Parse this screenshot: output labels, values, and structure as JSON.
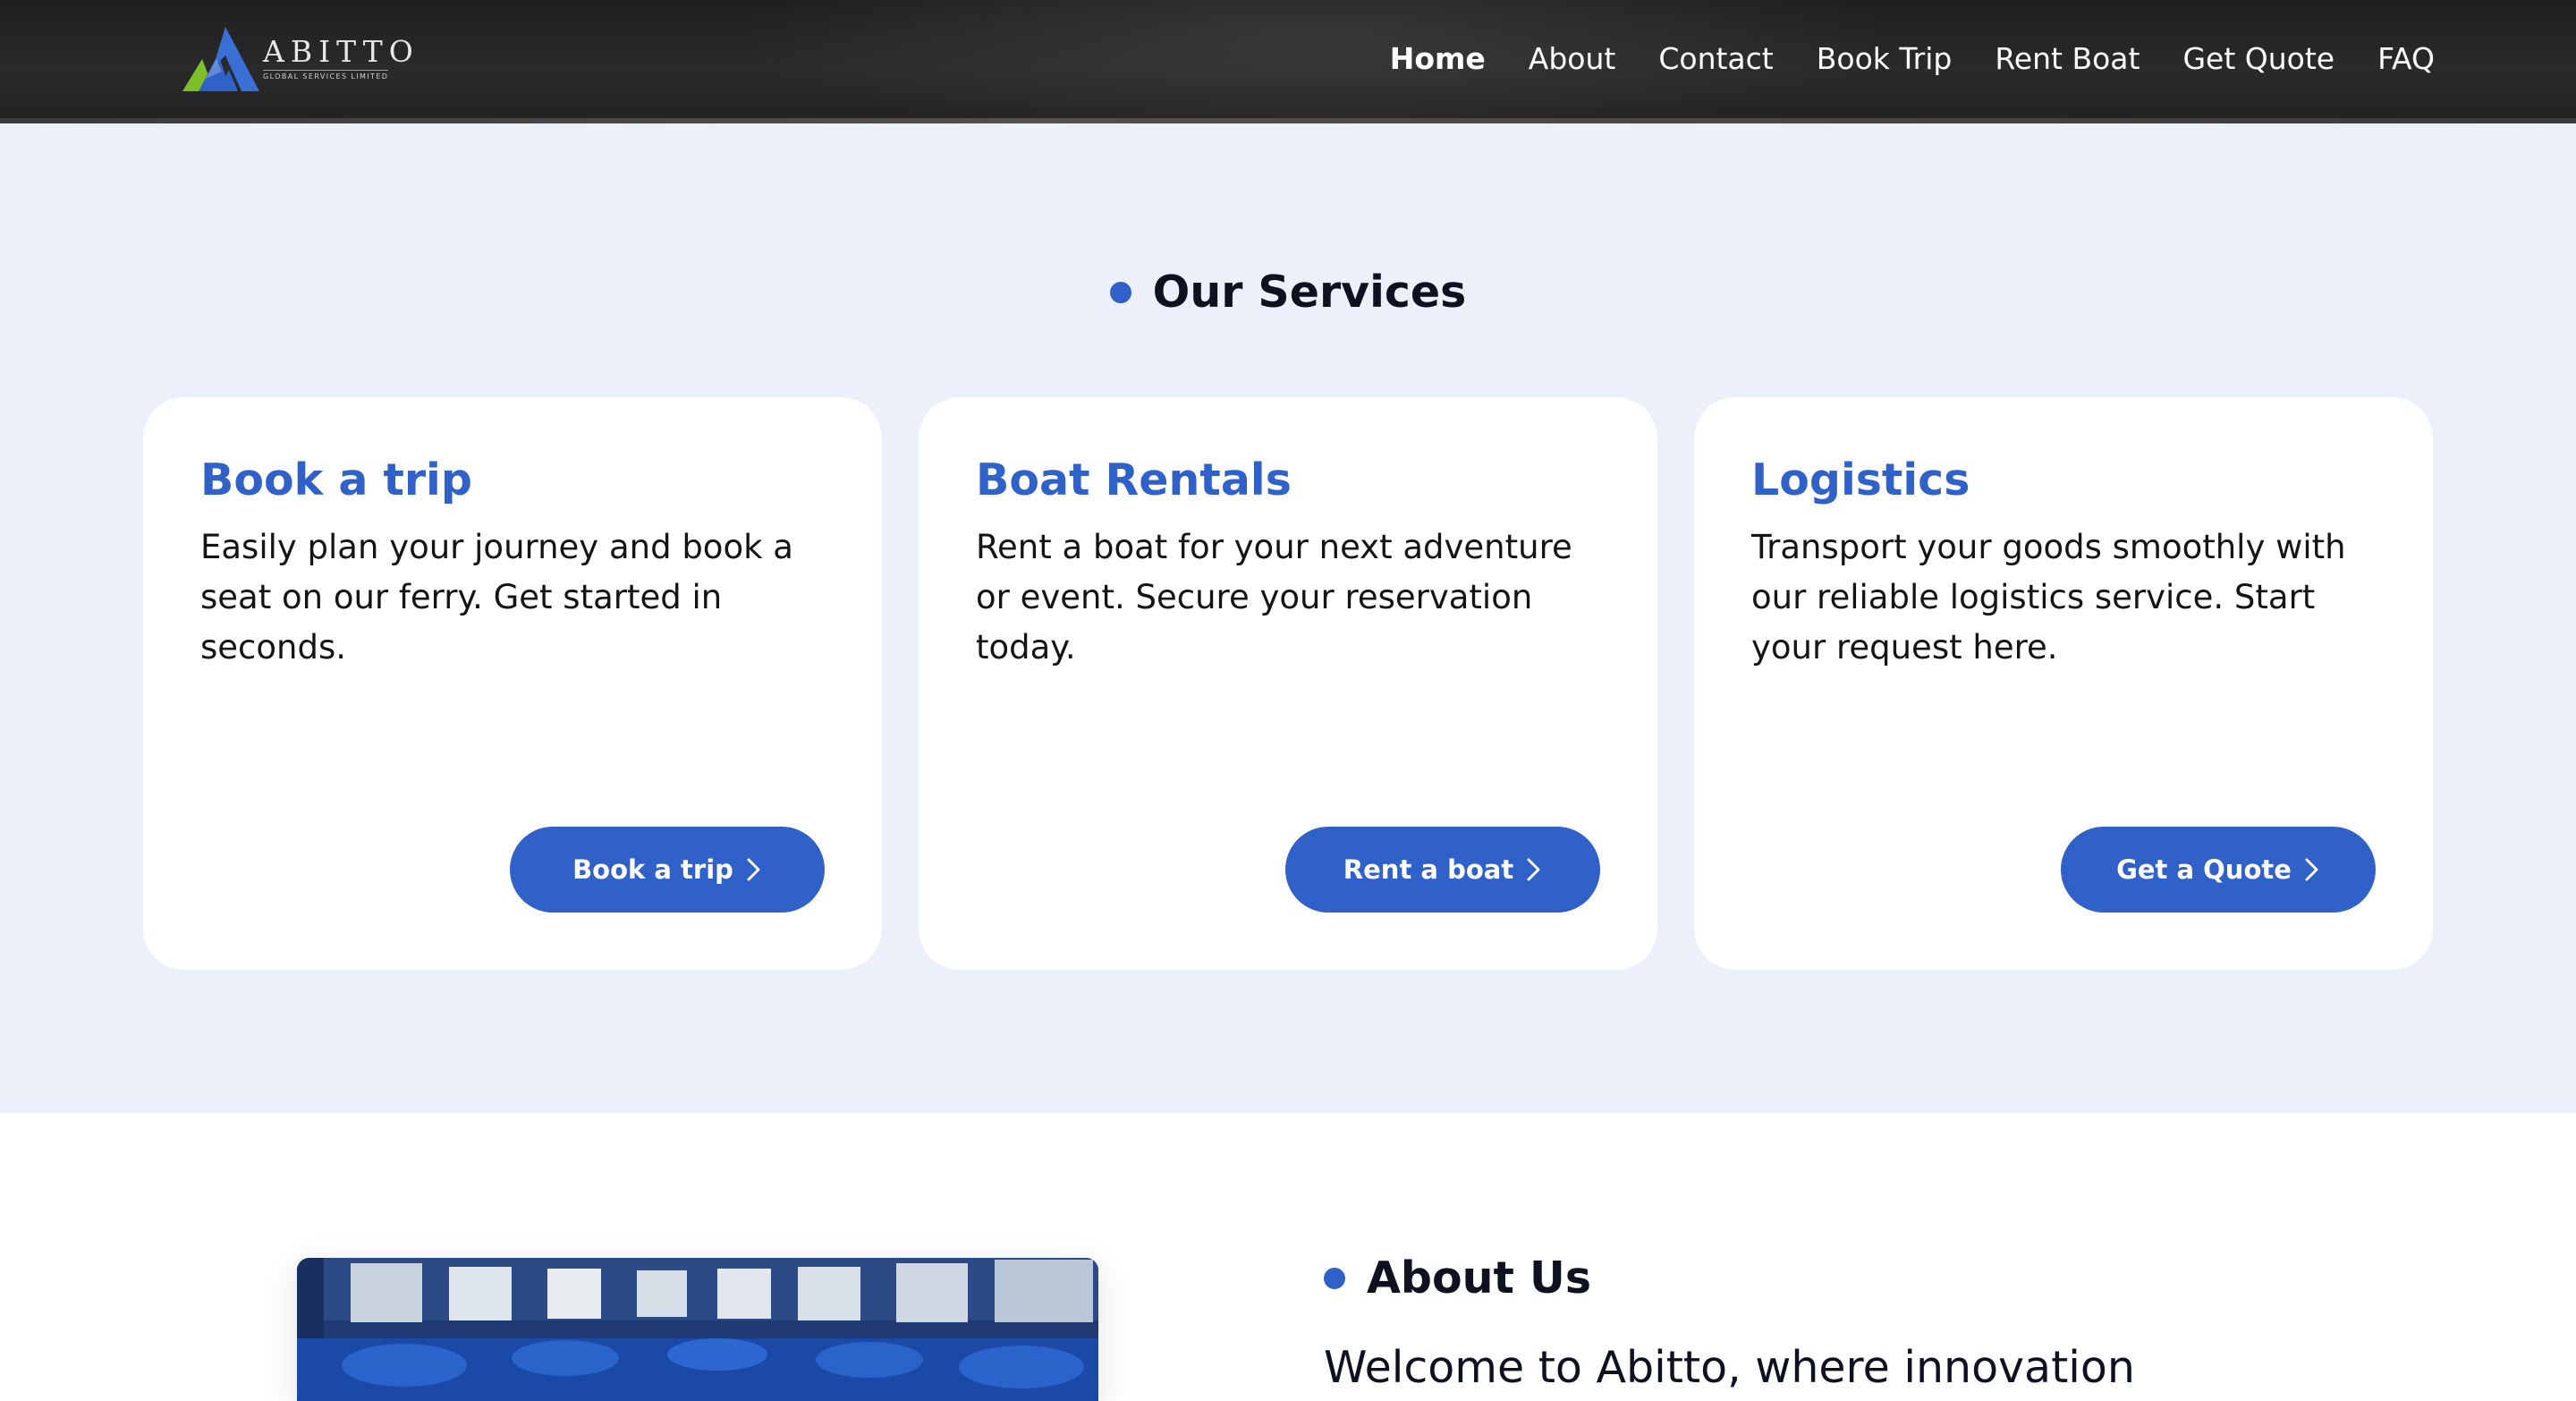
{
  "brand": {
    "name": "ABITTO",
    "tagline": "GLOBAL SERVICES LIMITED"
  },
  "nav": {
    "items": [
      {
        "label": "Home",
        "active": true
      },
      {
        "label": "About"
      },
      {
        "label": "Contact"
      },
      {
        "label": "Book Trip"
      },
      {
        "label": "Rent Boat"
      },
      {
        "label": "Get Quote"
      },
      {
        "label": "FAQ"
      }
    ]
  },
  "services": {
    "title": "Our Services",
    "cards": [
      {
        "title": "Book a trip",
        "description": "Easily plan your journey and book a seat on our ferry. Get started in seconds.",
        "button": "Book a trip"
      },
      {
        "title": "Boat Rentals",
        "description": "Rent a boat for your next adventure or event. Secure your reservation today.",
        "button": "Rent a boat"
      },
      {
        "title": "Logistics",
        "description": "Transport your goods smoothly with our reliable logistics service. Start your request here.",
        "button": "Get a Quote"
      }
    ]
  },
  "about": {
    "title": "About Us",
    "welcome": "Welcome to Abitto, where innovation"
  },
  "colors": {
    "accent": "#2f61c9",
    "section_bg": "#ebf0fb",
    "header_bg": "#222223"
  },
  "icons": {
    "button_arrow": "chevron-right-icon",
    "section_marker": "dot-icon"
  }
}
